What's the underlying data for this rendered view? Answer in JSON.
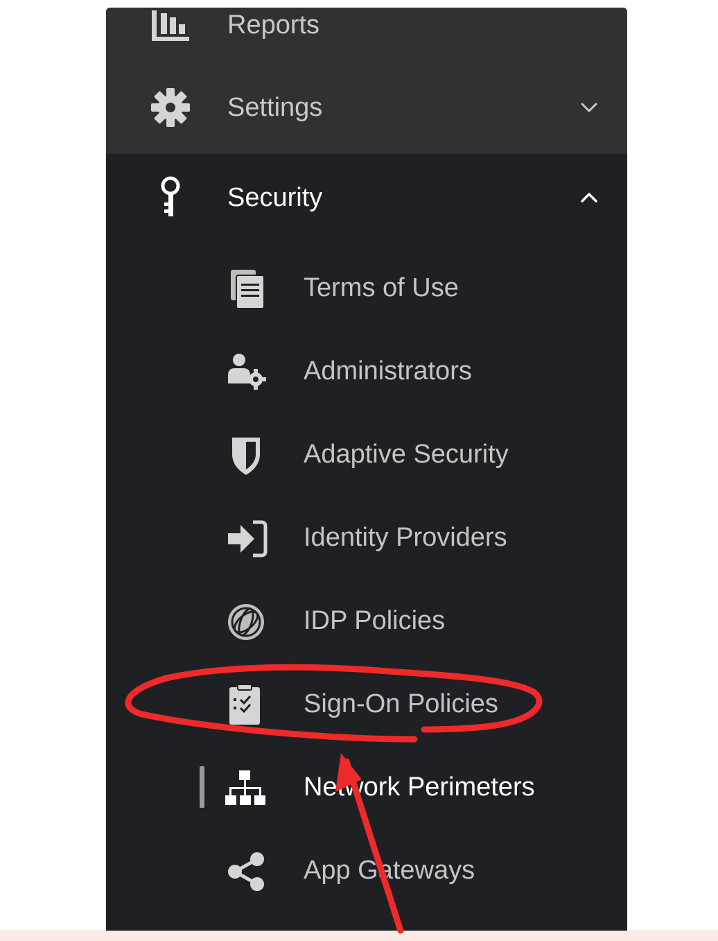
{
  "sidebar": {
    "top_items": [
      {
        "label": "Reports",
        "icon": "bar-chart-icon"
      },
      {
        "label": "Settings",
        "icon": "gear-icon",
        "chevron": "chevron-down-icon"
      }
    ],
    "security": {
      "label": "Security",
      "icon": "key-icon",
      "chevron": "chevron-up-icon",
      "expanded": true,
      "items": [
        {
          "label": "Terms of Use",
          "icon": "documents-icon"
        },
        {
          "label": "Administrators",
          "icon": "user-gear-icon"
        },
        {
          "label": "Adaptive Security",
          "icon": "shield-icon"
        },
        {
          "label": "Identity Providers",
          "icon": "sign-in-icon"
        },
        {
          "label": "IDP Policies",
          "icon": "globe-icon"
        },
        {
          "label": "Sign-On Policies",
          "icon": "clipboard-check-icon"
        },
        {
          "label": "Network Perimeters",
          "icon": "network-icon",
          "active": true
        },
        {
          "label": "App Gateways",
          "icon": "share-icon"
        }
      ]
    }
  },
  "colors": {
    "sidebar_bg": "#1f2023",
    "group_bg": "#303133",
    "text": "#c9c9c9",
    "active_text": "#ffffff",
    "annotation": "#ee2a2a"
  },
  "annotation": {
    "highlighted_item": "Sign-On Policies",
    "shapes": [
      "ellipse",
      "arrow"
    ]
  }
}
